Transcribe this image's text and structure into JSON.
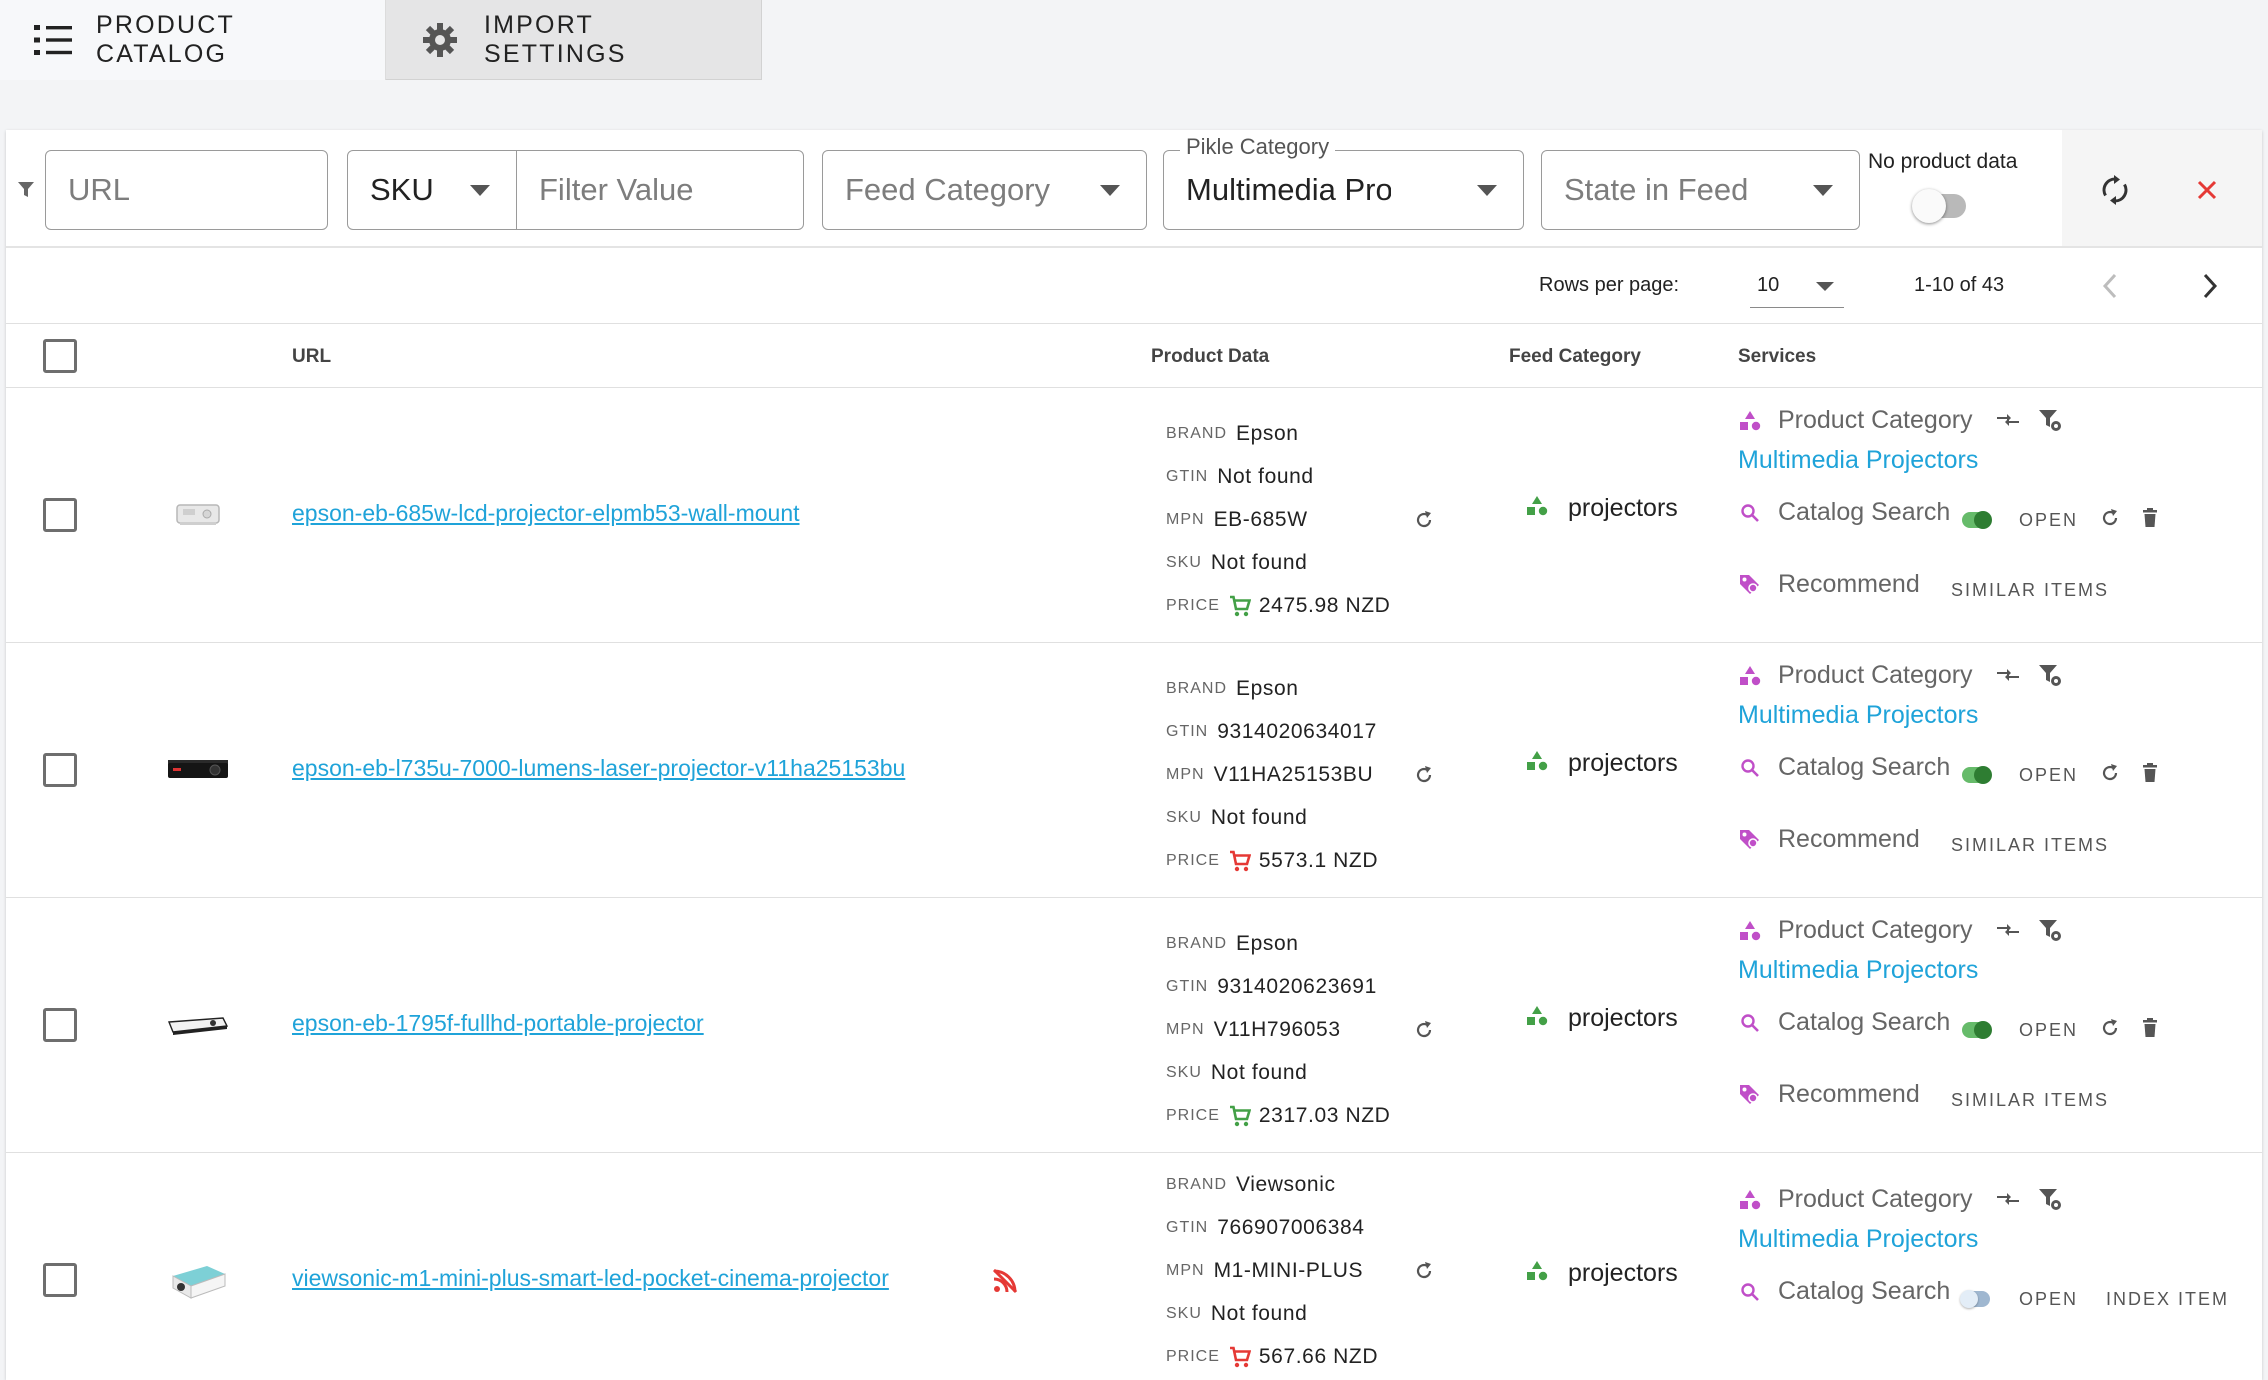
{
  "tabs": [
    {
      "label": "PRODUCT CATALOG",
      "icon": "list-icon"
    },
    {
      "label": "IMPORT SETTINGS",
      "icon": "gear-icon"
    }
  ],
  "filters": {
    "url_placeholder": "URL",
    "id_type": "SKU",
    "filter_value_placeholder": "Filter Value",
    "feed_category_placeholder": "Feed Category",
    "pikle_category_label": "Pikle Category",
    "pikle_category_value": "Multimedia Projectors",
    "state_placeholder": "State in Feed",
    "no_product_data_label": "No product data",
    "no_product_data_on": false
  },
  "pagination": {
    "rows_label": "Rows per page:",
    "rows_per_page": "10",
    "range": "1-10 of 43"
  },
  "columns": {
    "url": "URL",
    "product_data": "Product Data",
    "feed_category": "Feed Category",
    "services": "Services"
  },
  "labels": {
    "brand": "BRAND",
    "gtin": "GTIN",
    "mpn": "MPN",
    "sku": "SKU",
    "price": "PRICE",
    "product_category": "Product Category",
    "catalog_search": "Catalog Search",
    "recommend": "Recommend",
    "open": "OPEN",
    "similar_items": "SIMILAR ITEMS",
    "index_item": "INDEX ITEM"
  },
  "colors": {
    "link": "#1fa3d9",
    "price_ok": "#43a047",
    "price_warn": "#e53935",
    "service_icon": "#c04fc8",
    "feed_tri": "#43a047",
    "close": "#e53935"
  },
  "rows": [
    {
      "url": "epson-eb-685w-lcd-projector-elpmb53-wall-mount",
      "brand": "Epson",
      "gtin": "Not found",
      "mpn": "EB-685W",
      "sku": "Not found",
      "price": "2475.98 NZD",
      "price_status": "ok",
      "feed_category": "projectors",
      "product_category": "Multimedia Projectors",
      "catalog_search_enabled": true,
      "feed_error": false
    },
    {
      "url": "epson-eb-l735u-7000-lumens-laser-projector-v11ha25153bu",
      "brand": "Epson",
      "gtin": "9314020634017",
      "mpn": "V11HA25153BU",
      "sku": "Not found",
      "price": "5573.1 NZD",
      "price_status": "warn",
      "feed_category": "projectors",
      "product_category": "Multimedia Projectors",
      "catalog_search_enabled": true,
      "feed_error": false
    },
    {
      "url": "epson-eb-1795f-fullhd-portable-projector",
      "brand": "Epson",
      "gtin": "9314020623691",
      "mpn": "V11H796053",
      "sku": "Not found",
      "price": "2317.03 NZD",
      "price_status": "ok",
      "feed_category": "projectors",
      "product_category": "Multimedia Projectors",
      "catalog_search_enabled": true,
      "feed_error": false
    },
    {
      "url": "viewsonic-m1-mini-plus-smart-led-pocket-cinema-projector",
      "brand": "Viewsonic",
      "gtin": "766907006384",
      "mpn": "M1-MINI-PLUS",
      "sku": "Not found",
      "price": "567.66 NZD",
      "price_status": "warn",
      "feed_category": "projectors",
      "product_category": "Multimedia Projectors",
      "catalog_search_enabled": false,
      "feed_error": true
    }
  ]
}
